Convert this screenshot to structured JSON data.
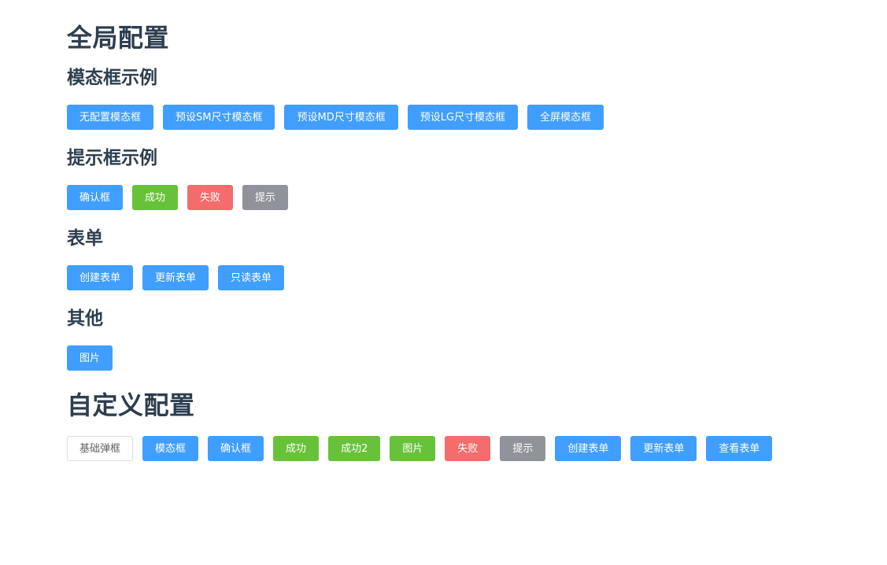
{
  "global_config": {
    "title": "全局配置",
    "modal_section": {
      "title": "模态框示例",
      "buttons": [
        "无配置模态框",
        "预设SM尺寸模态框",
        "预设MD尺寸模态框",
        "预设LG尺寸模态框",
        "全屏模态框"
      ]
    },
    "tip_section": {
      "title": "提示框示例",
      "buttons": [
        "确认框",
        "成功",
        "失败",
        "提示"
      ]
    },
    "form_section": {
      "title": "表单",
      "buttons": [
        "创建表单",
        "更新表单",
        "只读表单"
      ]
    },
    "other_section": {
      "title": "其他",
      "buttons": [
        "图片"
      ]
    }
  },
  "custom_config": {
    "title": "自定义配置",
    "buttons": [
      "基础弹框",
      "模态框",
      "确认框",
      "成功",
      "成功2",
      "图片",
      "失败",
      "提示",
      "创建表单",
      "更新表单",
      "查看表单"
    ]
  },
  "colors": {
    "primary": "#409eff",
    "success": "#67c23a",
    "danger": "#f56c6c",
    "info": "#909399",
    "default_border": "#dcdfe6",
    "heading_text": "#2c3e50"
  }
}
